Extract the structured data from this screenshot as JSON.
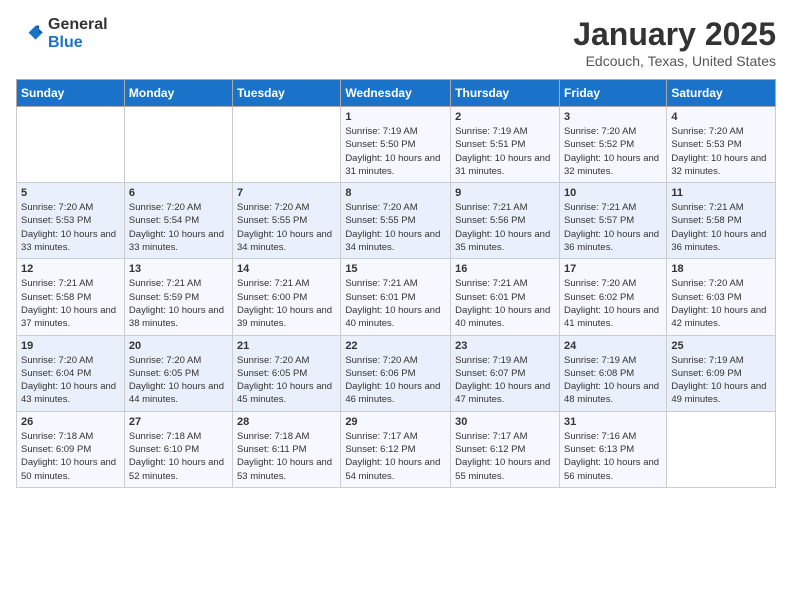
{
  "header": {
    "logo_general": "General",
    "logo_blue": "Blue",
    "title": "January 2025",
    "subtitle": "Edcouch, Texas, United States"
  },
  "days_of_week": [
    "Sunday",
    "Monday",
    "Tuesday",
    "Wednesday",
    "Thursday",
    "Friday",
    "Saturday"
  ],
  "weeks": [
    [
      {
        "day": "",
        "sunrise": "",
        "sunset": "",
        "daylight": ""
      },
      {
        "day": "",
        "sunrise": "",
        "sunset": "",
        "daylight": ""
      },
      {
        "day": "",
        "sunrise": "",
        "sunset": "",
        "daylight": ""
      },
      {
        "day": "1",
        "sunrise": "Sunrise: 7:19 AM",
        "sunset": "Sunset: 5:50 PM",
        "daylight": "Daylight: 10 hours and 31 minutes."
      },
      {
        "day": "2",
        "sunrise": "Sunrise: 7:19 AM",
        "sunset": "Sunset: 5:51 PM",
        "daylight": "Daylight: 10 hours and 31 minutes."
      },
      {
        "day": "3",
        "sunrise": "Sunrise: 7:20 AM",
        "sunset": "Sunset: 5:52 PM",
        "daylight": "Daylight: 10 hours and 32 minutes."
      },
      {
        "day": "4",
        "sunrise": "Sunrise: 7:20 AM",
        "sunset": "Sunset: 5:53 PM",
        "daylight": "Daylight: 10 hours and 32 minutes."
      }
    ],
    [
      {
        "day": "5",
        "sunrise": "Sunrise: 7:20 AM",
        "sunset": "Sunset: 5:53 PM",
        "daylight": "Daylight: 10 hours and 33 minutes."
      },
      {
        "day": "6",
        "sunrise": "Sunrise: 7:20 AM",
        "sunset": "Sunset: 5:54 PM",
        "daylight": "Daylight: 10 hours and 33 minutes."
      },
      {
        "day": "7",
        "sunrise": "Sunrise: 7:20 AM",
        "sunset": "Sunset: 5:55 PM",
        "daylight": "Daylight: 10 hours and 34 minutes."
      },
      {
        "day": "8",
        "sunrise": "Sunrise: 7:20 AM",
        "sunset": "Sunset: 5:55 PM",
        "daylight": "Daylight: 10 hours and 34 minutes."
      },
      {
        "day": "9",
        "sunrise": "Sunrise: 7:21 AM",
        "sunset": "Sunset: 5:56 PM",
        "daylight": "Daylight: 10 hours and 35 minutes."
      },
      {
        "day": "10",
        "sunrise": "Sunrise: 7:21 AM",
        "sunset": "Sunset: 5:57 PM",
        "daylight": "Daylight: 10 hours and 36 minutes."
      },
      {
        "day": "11",
        "sunrise": "Sunrise: 7:21 AM",
        "sunset": "Sunset: 5:58 PM",
        "daylight": "Daylight: 10 hours and 36 minutes."
      }
    ],
    [
      {
        "day": "12",
        "sunrise": "Sunrise: 7:21 AM",
        "sunset": "Sunset: 5:58 PM",
        "daylight": "Daylight: 10 hours and 37 minutes."
      },
      {
        "day": "13",
        "sunrise": "Sunrise: 7:21 AM",
        "sunset": "Sunset: 5:59 PM",
        "daylight": "Daylight: 10 hours and 38 minutes."
      },
      {
        "day": "14",
        "sunrise": "Sunrise: 7:21 AM",
        "sunset": "Sunset: 6:00 PM",
        "daylight": "Daylight: 10 hours and 39 minutes."
      },
      {
        "day": "15",
        "sunrise": "Sunrise: 7:21 AM",
        "sunset": "Sunset: 6:01 PM",
        "daylight": "Daylight: 10 hours and 40 minutes."
      },
      {
        "day": "16",
        "sunrise": "Sunrise: 7:21 AM",
        "sunset": "Sunset: 6:01 PM",
        "daylight": "Daylight: 10 hours and 40 minutes."
      },
      {
        "day": "17",
        "sunrise": "Sunrise: 7:20 AM",
        "sunset": "Sunset: 6:02 PM",
        "daylight": "Daylight: 10 hours and 41 minutes."
      },
      {
        "day": "18",
        "sunrise": "Sunrise: 7:20 AM",
        "sunset": "Sunset: 6:03 PM",
        "daylight": "Daylight: 10 hours and 42 minutes."
      }
    ],
    [
      {
        "day": "19",
        "sunrise": "Sunrise: 7:20 AM",
        "sunset": "Sunset: 6:04 PM",
        "daylight": "Daylight: 10 hours and 43 minutes."
      },
      {
        "day": "20",
        "sunrise": "Sunrise: 7:20 AM",
        "sunset": "Sunset: 6:05 PM",
        "daylight": "Daylight: 10 hours and 44 minutes."
      },
      {
        "day": "21",
        "sunrise": "Sunrise: 7:20 AM",
        "sunset": "Sunset: 6:05 PM",
        "daylight": "Daylight: 10 hours and 45 minutes."
      },
      {
        "day": "22",
        "sunrise": "Sunrise: 7:20 AM",
        "sunset": "Sunset: 6:06 PM",
        "daylight": "Daylight: 10 hours and 46 minutes."
      },
      {
        "day": "23",
        "sunrise": "Sunrise: 7:19 AM",
        "sunset": "Sunset: 6:07 PM",
        "daylight": "Daylight: 10 hours and 47 minutes."
      },
      {
        "day": "24",
        "sunrise": "Sunrise: 7:19 AM",
        "sunset": "Sunset: 6:08 PM",
        "daylight": "Daylight: 10 hours and 48 minutes."
      },
      {
        "day": "25",
        "sunrise": "Sunrise: 7:19 AM",
        "sunset": "Sunset: 6:09 PM",
        "daylight": "Daylight: 10 hours and 49 minutes."
      }
    ],
    [
      {
        "day": "26",
        "sunrise": "Sunrise: 7:18 AM",
        "sunset": "Sunset: 6:09 PM",
        "daylight": "Daylight: 10 hours and 50 minutes."
      },
      {
        "day": "27",
        "sunrise": "Sunrise: 7:18 AM",
        "sunset": "Sunset: 6:10 PM",
        "daylight": "Daylight: 10 hours and 52 minutes."
      },
      {
        "day": "28",
        "sunrise": "Sunrise: 7:18 AM",
        "sunset": "Sunset: 6:11 PM",
        "daylight": "Daylight: 10 hours and 53 minutes."
      },
      {
        "day": "29",
        "sunrise": "Sunrise: 7:17 AM",
        "sunset": "Sunset: 6:12 PM",
        "daylight": "Daylight: 10 hours and 54 minutes."
      },
      {
        "day": "30",
        "sunrise": "Sunrise: 7:17 AM",
        "sunset": "Sunset: 6:12 PM",
        "daylight": "Daylight: 10 hours and 55 minutes."
      },
      {
        "day": "31",
        "sunrise": "Sunrise: 7:16 AM",
        "sunset": "Sunset: 6:13 PM",
        "daylight": "Daylight: 10 hours and 56 minutes."
      },
      {
        "day": "",
        "sunrise": "",
        "sunset": "",
        "daylight": ""
      }
    ]
  ]
}
